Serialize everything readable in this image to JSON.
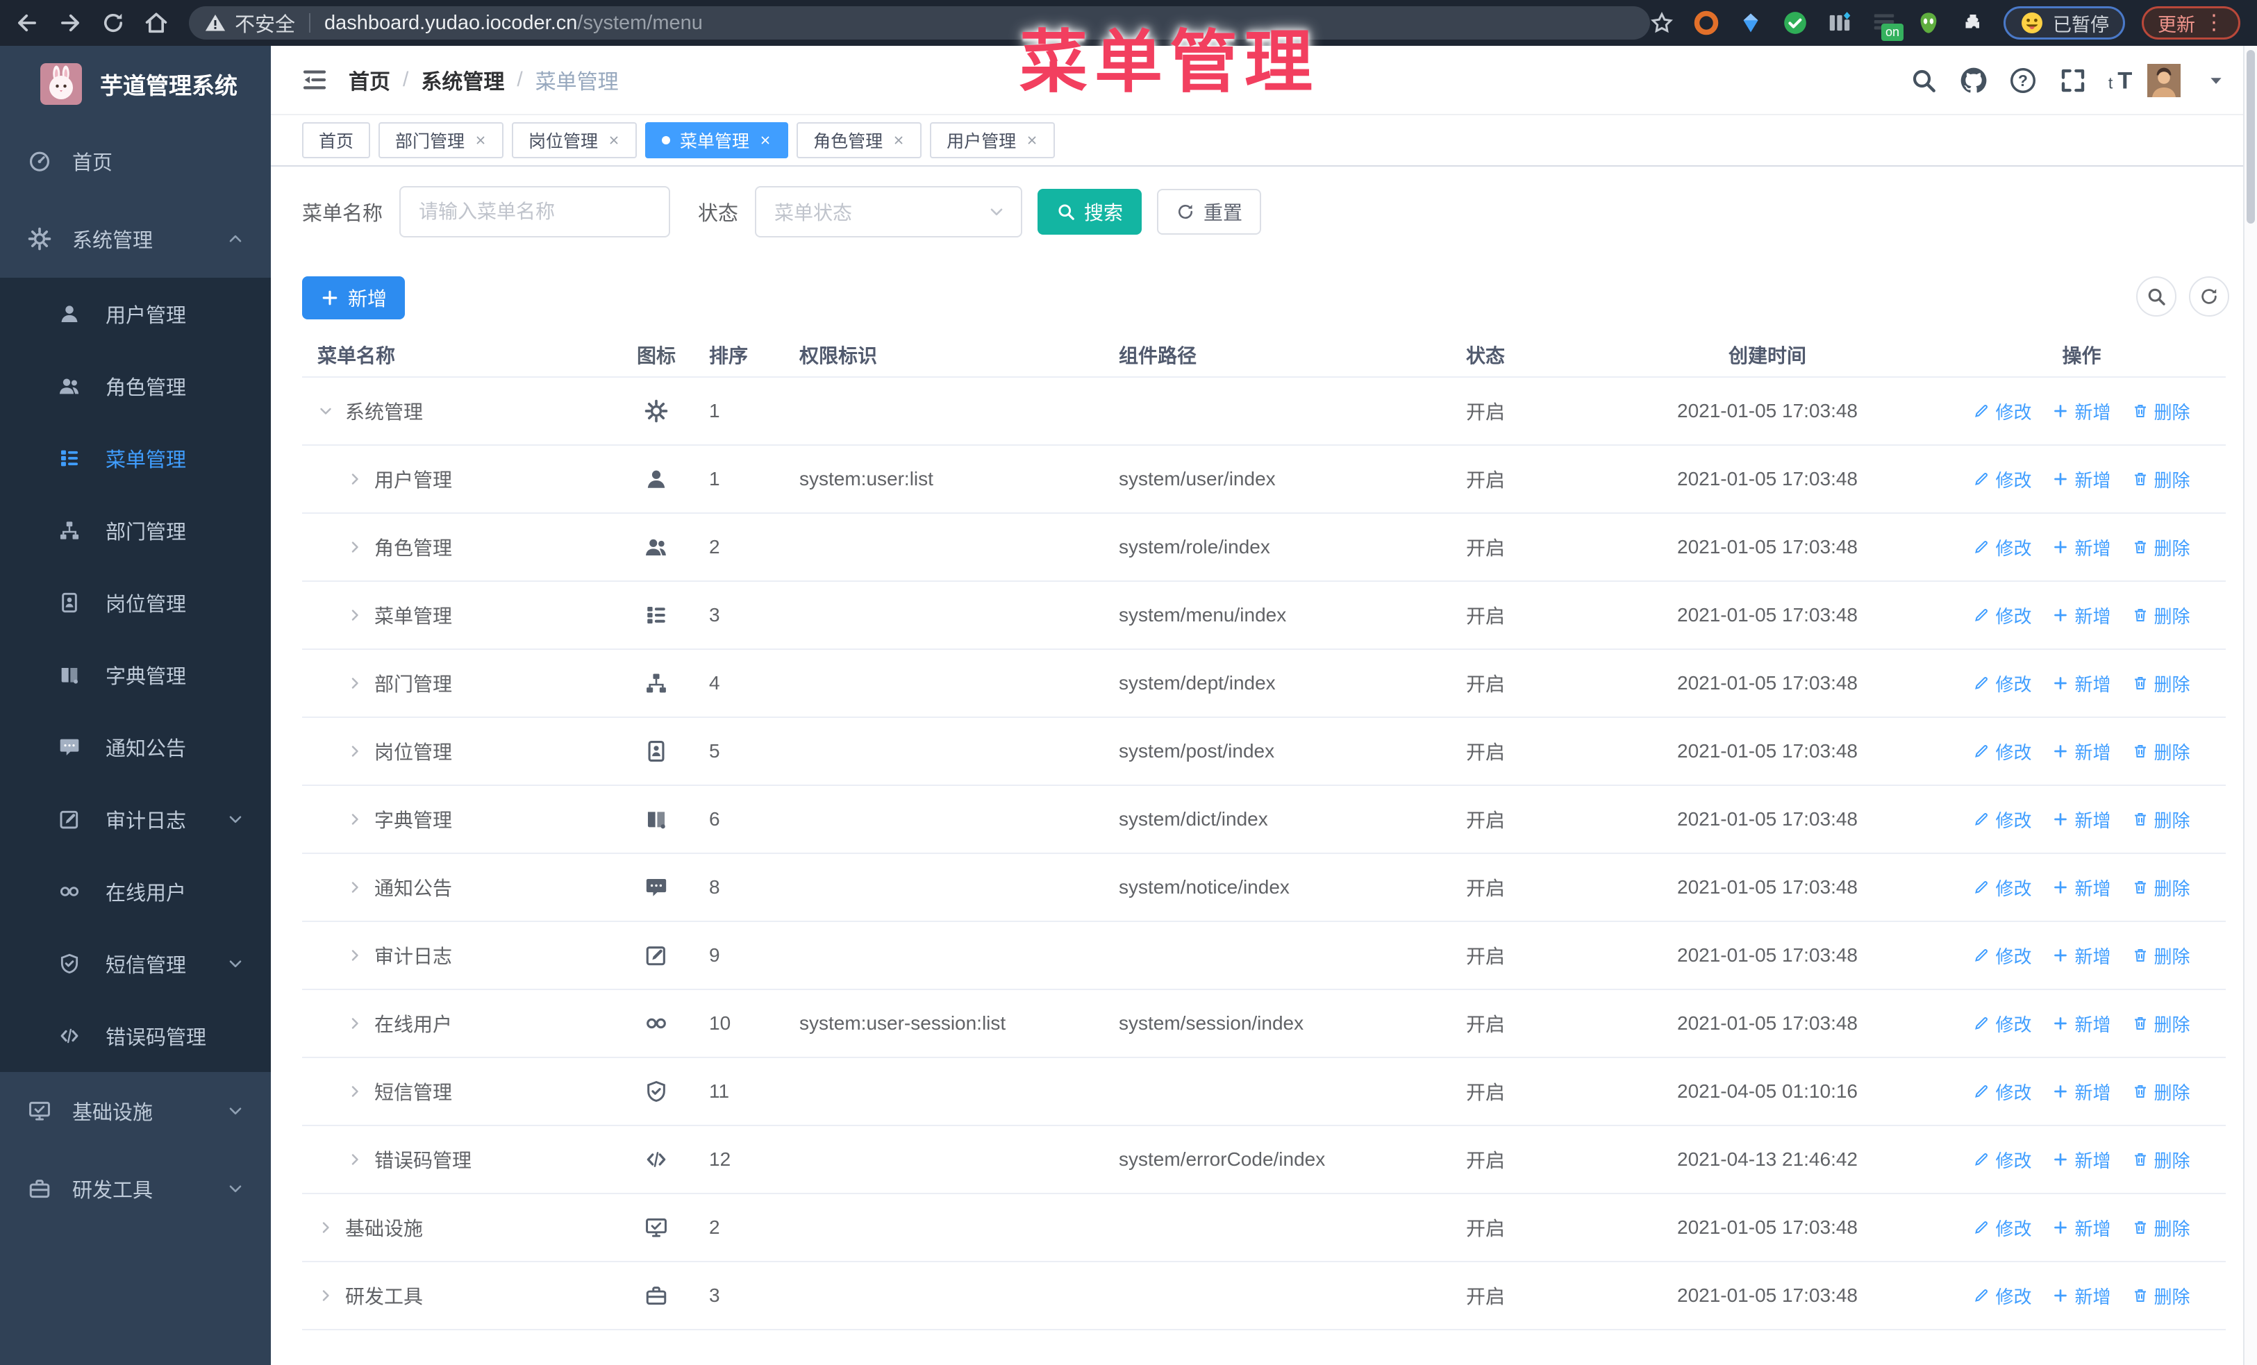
{
  "browser": {
    "security_label": "不安全",
    "url_host": "dashboard.yudao.iocoder.cn",
    "url_path": "/system/menu",
    "paused_badge": "已暂停",
    "update_label": "更新",
    "on_badge": "on"
  },
  "watermark": "菜单管理",
  "sidebar": {
    "title": "芋道管理系统",
    "items": [
      {
        "label": "首页",
        "icon": "dashboard-icon"
      },
      {
        "label": "系统管理",
        "icon": "gear-icon",
        "expanded": true,
        "chevron": "up",
        "children": [
          {
            "label": "用户管理",
            "icon": "user-icon"
          },
          {
            "label": "角色管理",
            "icon": "users-icon"
          },
          {
            "label": "菜单管理",
            "icon": "menu-icon",
            "active": true
          },
          {
            "label": "部门管理",
            "icon": "tree-icon"
          },
          {
            "label": "岗位管理",
            "icon": "idcard-icon"
          },
          {
            "label": "字典管理",
            "icon": "book-icon"
          },
          {
            "label": "通知公告",
            "icon": "message-icon"
          },
          {
            "label": "审计日志",
            "icon": "edit-icon",
            "chevron": "down"
          },
          {
            "label": "在线用户",
            "icon": "link-icon"
          },
          {
            "label": "短信管理",
            "icon": "shield-icon",
            "chevron": "down"
          },
          {
            "label": "错误码管理",
            "icon": "code-icon"
          }
        ]
      },
      {
        "label": "基础设施",
        "icon": "monitor-icon",
        "chevron": "down"
      },
      {
        "label": "研发工具",
        "icon": "toolbox-icon",
        "chevron": "down"
      }
    ]
  },
  "header": {
    "breadcrumb": [
      "首页",
      "系统管理",
      "菜单管理"
    ]
  },
  "tabs": [
    {
      "label": "首页"
    },
    {
      "label": "部门管理",
      "closable": true
    },
    {
      "label": "岗位管理",
      "closable": true
    },
    {
      "label": "菜单管理",
      "closable": true,
      "active": true
    },
    {
      "label": "角色管理",
      "closable": true
    },
    {
      "label": "用户管理",
      "closable": true
    }
  ],
  "filters": {
    "name_label": "菜单名称",
    "name_placeholder": "请输入菜单名称",
    "status_label": "状态",
    "status_placeholder": "菜单状态",
    "search_label": "搜索",
    "reset_label": "重置"
  },
  "toolbar": {
    "add_label": "新增"
  },
  "table": {
    "columns": [
      "菜单名称",
      "图标",
      "排序",
      "权限标识",
      "组件路径",
      "状态",
      "创建时间",
      "操作"
    ],
    "actions": [
      "修改",
      "新增",
      "删除"
    ],
    "rows": [
      {
        "name": "系统管理",
        "level": 0,
        "expanded": true,
        "icon": "gear-icon",
        "sort": "1",
        "perm": "",
        "path": "",
        "status": "开启",
        "time": "2021-01-05 17:03:48"
      },
      {
        "name": "用户管理",
        "level": 1,
        "expanded": false,
        "icon": "user-icon",
        "sort": "1",
        "perm": "system:user:list",
        "path": "system/user/index",
        "status": "开启",
        "time": "2021-01-05 17:03:48"
      },
      {
        "name": "角色管理",
        "level": 1,
        "expanded": false,
        "icon": "users-icon",
        "sort": "2",
        "perm": "",
        "path": "system/role/index",
        "status": "开启",
        "time": "2021-01-05 17:03:48"
      },
      {
        "name": "菜单管理",
        "level": 1,
        "expanded": false,
        "icon": "menu-icon",
        "sort": "3",
        "perm": "",
        "path": "system/menu/index",
        "status": "开启",
        "time": "2021-01-05 17:03:48"
      },
      {
        "name": "部门管理",
        "level": 1,
        "expanded": false,
        "icon": "tree-icon",
        "sort": "4",
        "perm": "",
        "path": "system/dept/index",
        "status": "开启",
        "time": "2021-01-05 17:03:48"
      },
      {
        "name": "岗位管理",
        "level": 1,
        "expanded": false,
        "icon": "idcard-icon",
        "sort": "5",
        "perm": "",
        "path": "system/post/index",
        "status": "开启",
        "time": "2021-01-05 17:03:48"
      },
      {
        "name": "字典管理",
        "level": 1,
        "expanded": false,
        "icon": "book-icon",
        "sort": "6",
        "perm": "",
        "path": "system/dict/index",
        "status": "开启",
        "time": "2021-01-05 17:03:48"
      },
      {
        "name": "通知公告",
        "level": 1,
        "expanded": false,
        "icon": "message-icon",
        "sort": "8",
        "perm": "",
        "path": "system/notice/index",
        "status": "开启",
        "time": "2021-01-05 17:03:48"
      },
      {
        "name": "审计日志",
        "level": 1,
        "expanded": false,
        "icon": "edit-icon",
        "sort": "9",
        "perm": "",
        "path": "",
        "status": "开启",
        "time": "2021-01-05 17:03:48"
      },
      {
        "name": "在线用户",
        "level": 1,
        "expanded": false,
        "icon": "link-icon",
        "sort": "10",
        "perm": "system:user-session:list",
        "path": "system/session/index",
        "status": "开启",
        "time": "2021-01-05 17:03:48"
      },
      {
        "name": "短信管理",
        "level": 1,
        "expanded": false,
        "icon": "shield-icon",
        "sort": "11",
        "perm": "",
        "path": "",
        "status": "开启",
        "time": "2021-04-05 01:10:16"
      },
      {
        "name": "错误码管理",
        "level": 1,
        "expanded": false,
        "icon": "code-icon",
        "sort": "12",
        "perm": "",
        "path": "system/errorCode/index",
        "status": "开启",
        "time": "2021-04-13 21:46:42"
      },
      {
        "name": "基础设施",
        "level": 0,
        "expanded": false,
        "icon": "monitor-icon",
        "sort": "2",
        "perm": "",
        "path": "",
        "status": "开启",
        "time": "2021-01-05 17:03:48"
      },
      {
        "name": "研发工具",
        "level": 0,
        "expanded": false,
        "icon": "toolbox-icon",
        "sort": "3",
        "perm": "",
        "path": "",
        "status": "开启",
        "time": "2021-01-05 17:03:48"
      }
    ]
  }
}
